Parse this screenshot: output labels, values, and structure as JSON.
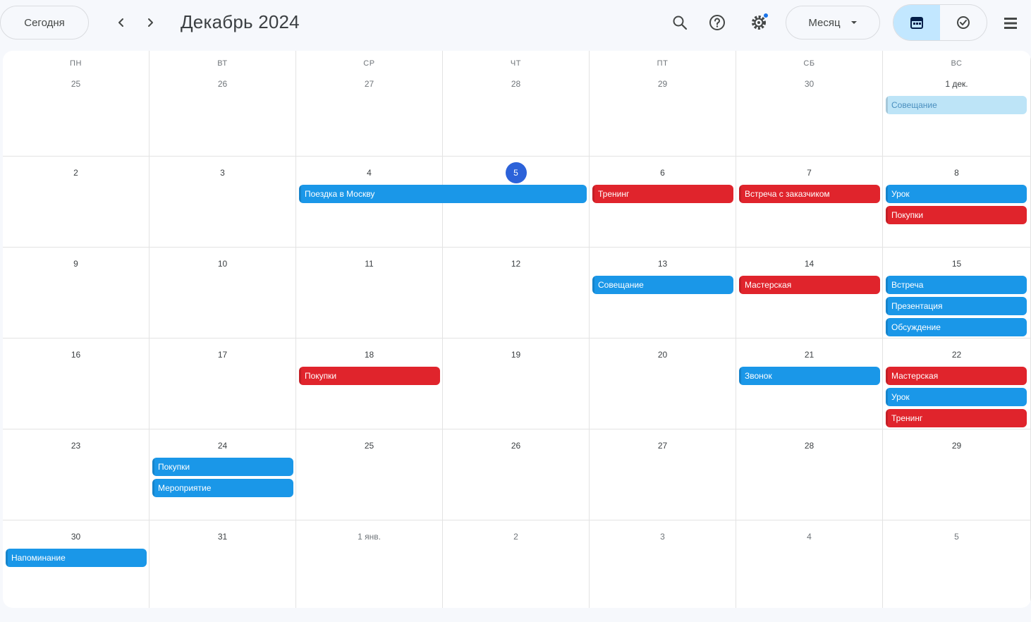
{
  "header": {
    "today_label": "Сегодня",
    "month_title": "Декабрь 2024",
    "view_select_label": "Месяц",
    "icons": [
      "search-icon",
      "help-icon",
      "settings-icon",
      "calendar-view-icon",
      "tasks-view-icon",
      "apps-grid-icon"
    ]
  },
  "colors": {
    "event_blue": "#1a97e8",
    "event_red": "#e0242c",
    "event_pale": "#bde4f7",
    "today_circle": "#2c62d9",
    "toggle_active": "#c2e7ff"
  },
  "weekdays": [
    "ПН",
    "ВТ",
    "СР",
    "ЧТ",
    "ПТ",
    "СБ",
    "ВС"
  ],
  "weeks": [
    {
      "days": [
        "25",
        "26",
        "27",
        "28",
        "29",
        "30",
        "1 дек."
      ],
      "muted": [
        true,
        true,
        true,
        true,
        true,
        true,
        false
      ],
      "events": [
        {
          "start": 6,
          "span": 1,
          "lane": 0,
          "color": "pale",
          "title": "Совещание"
        }
      ]
    },
    {
      "days": [
        "2",
        "3",
        "4",
        "5",
        "6",
        "7",
        "8"
      ],
      "today_index": 3,
      "events": [
        {
          "start": 2,
          "span": 2,
          "lane": 0,
          "color": "blue",
          "title": "Поездка в Москву"
        },
        {
          "start": 4,
          "span": 1,
          "lane": 0,
          "color": "red",
          "title": "Тренинг"
        },
        {
          "start": 5,
          "span": 1,
          "lane": 0,
          "color": "red",
          "title": "Встреча с заказчиком"
        },
        {
          "start": 6,
          "span": 1,
          "lane": 0,
          "color": "blue",
          "title": "Урок"
        },
        {
          "start": 6,
          "span": 1,
          "lane": 1,
          "color": "red",
          "title": "Покупки"
        }
      ]
    },
    {
      "days": [
        "9",
        "10",
        "11",
        "12",
        "13",
        "14",
        "15"
      ],
      "events": [
        {
          "start": 4,
          "span": 1,
          "lane": 0,
          "color": "blue",
          "title": "Совещание"
        },
        {
          "start": 5,
          "span": 1,
          "lane": 0,
          "color": "red",
          "title": "Мастерская"
        },
        {
          "start": 6,
          "span": 1,
          "lane": 0,
          "color": "blue",
          "title": "Встреча"
        },
        {
          "start": 6,
          "span": 1,
          "lane": 1,
          "color": "blue",
          "title": "Презентация"
        },
        {
          "start": 6,
          "span": 1,
          "lane": 2,
          "color": "blue",
          "title": "Обсуждение"
        }
      ]
    },
    {
      "days": [
        "16",
        "17",
        "18",
        "19",
        "20",
        "21",
        "22"
      ],
      "events": [
        {
          "start": 2,
          "span": 1,
          "lane": 0,
          "color": "red",
          "title": "Покупки"
        },
        {
          "start": 5,
          "span": 1,
          "lane": 0,
          "color": "blue",
          "title": "Звонок"
        },
        {
          "start": 6,
          "span": 1,
          "lane": 0,
          "color": "red",
          "title": "Мастерская"
        },
        {
          "start": 6,
          "span": 1,
          "lane": 1,
          "color": "blue",
          "title": "Урок"
        },
        {
          "start": 6,
          "span": 1,
          "lane": 2,
          "color": "red",
          "title": "Тренинг"
        }
      ]
    },
    {
      "days": [
        "23",
        "24",
        "25",
        "26",
        "27",
        "28",
        "29"
      ],
      "events": [
        {
          "start": 1,
          "span": 1,
          "lane": 0,
          "color": "blue",
          "title": "Покупки"
        },
        {
          "start": 1,
          "span": 1,
          "lane": 1,
          "color": "blue",
          "title": "Мероприятие"
        }
      ]
    },
    {
      "days": [
        "30",
        "31",
        "1 янв.",
        "2",
        "3",
        "4",
        "5"
      ],
      "muted": [
        false,
        false,
        true,
        true,
        true,
        true,
        true
      ],
      "events": [
        {
          "start": 0,
          "span": 1,
          "lane": 0,
          "color": "blue",
          "title": "Напоминание"
        }
      ]
    }
  ]
}
